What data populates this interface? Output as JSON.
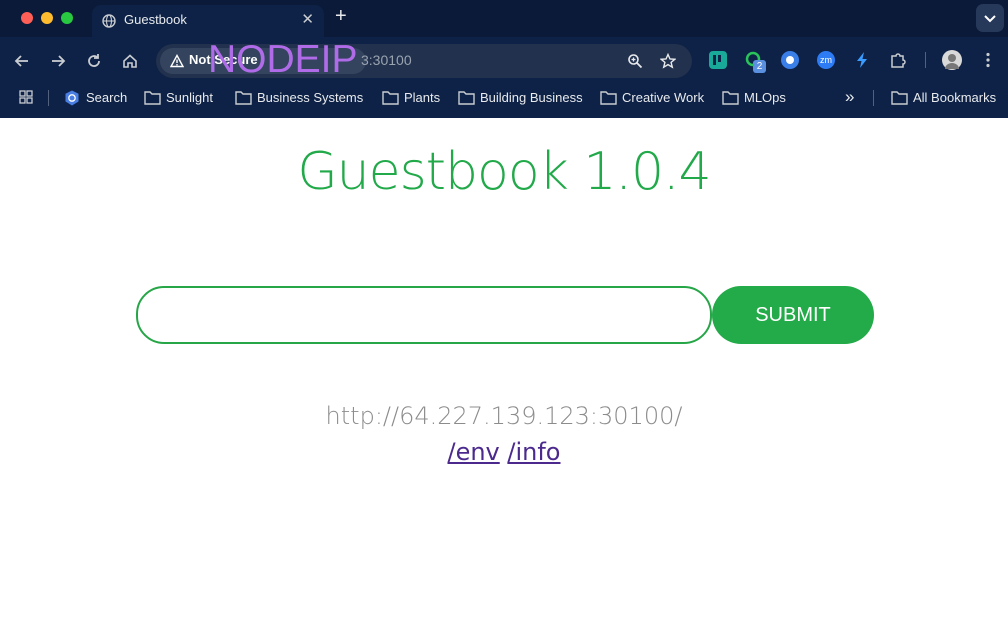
{
  "browser": {
    "tab_title": "Guestbook",
    "new_tab_glyph": "+",
    "tab_close_glyph": "✕",
    "security_chip": "Not Secure",
    "url_visible": "3:30100",
    "overlay_text": "NODEIP",
    "extension_badge": "2",
    "extension_zm": "zm",
    "bookmarks": [
      {
        "label": "Search",
        "icon": "kubernetes-icon"
      },
      {
        "label": "Sunlight",
        "icon": "folder-icon"
      },
      {
        "label": "Business Systems",
        "icon": "folder-icon"
      },
      {
        "label": "Plants",
        "icon": "folder-icon"
      },
      {
        "label": "Building Business",
        "icon": "folder-icon"
      },
      {
        "label": "Creative Work",
        "icon": "folder-icon"
      },
      {
        "label": "MLOps",
        "icon": "folder-icon"
      }
    ],
    "overflow_glyph": "»",
    "all_bookmarks": "All Bookmarks"
  },
  "page": {
    "title": "Guestbook 1.0.4",
    "entry_value": "",
    "submit_label": "SUBMIT",
    "host": "http://64.227.139.123:30100/",
    "link_env": "/env",
    "link_info": "/info"
  },
  "colors": {
    "brand_green": "#22a94a",
    "link_purple": "#4c2a8d",
    "chrome_bg": "#0d2246",
    "overlay_purple": "#b06ce8"
  }
}
